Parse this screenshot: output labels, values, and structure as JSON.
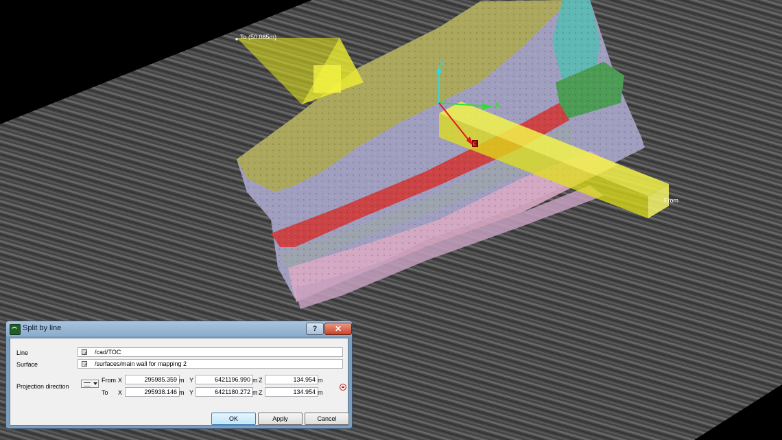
{
  "viewport": {
    "to_label": "To (50.085m)",
    "from_label": "From",
    "axis_z": "Z",
    "axis_n": "N",
    "axis_e": "E"
  },
  "dialog": {
    "title": "Split by line",
    "help_label": "?",
    "close_label": "✕",
    "line_label": "Line",
    "line_value": "/cad/TOC",
    "surface_label": "Surface",
    "surface_value": "/surfaces/main wall for mapping 2",
    "projection_label": "Projection direction",
    "from_label": "From",
    "to_label": "To",
    "x_label": "X",
    "y_label": "Y",
    "z_label": "Z",
    "unit": "m",
    "from": {
      "x": "295985.359",
      "y": "6421196.990",
      "z": "134.954"
    },
    "to": {
      "x": "295938.146",
      "y": "6421180.272",
      "z": "134.954"
    },
    "ok_label": "OK",
    "apply_label": "Apply",
    "cancel_label": "Cancel"
  }
}
